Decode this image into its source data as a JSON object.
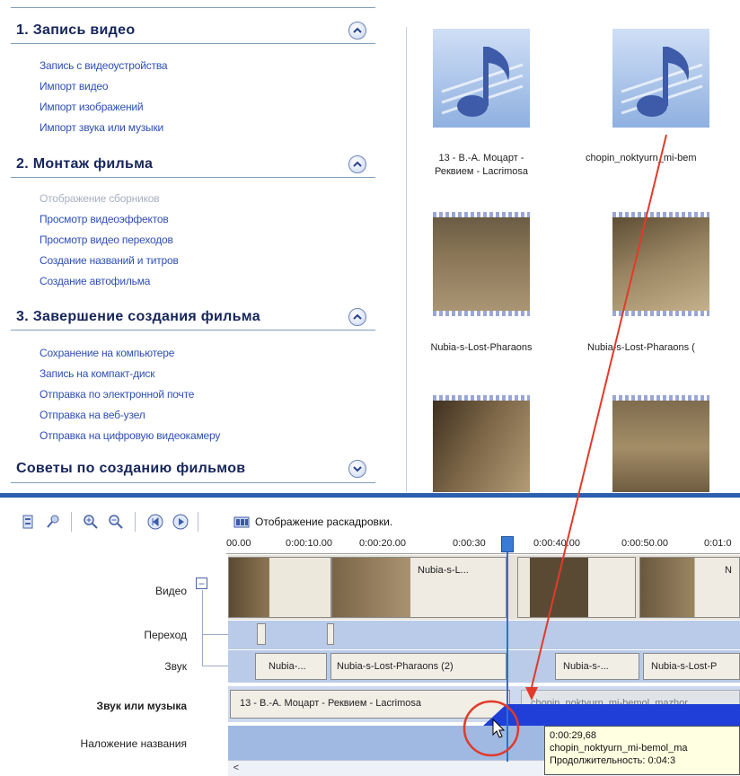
{
  "task_pane": {
    "sections": [
      {
        "title": "1. Запись видео",
        "links": [
          "Запись с видеоустройства",
          "Импорт видео",
          "Импорт изображений",
          "Импорт звука или музыки"
        ],
        "disabled_links": []
      },
      {
        "title": "2. Монтаж фильма",
        "links": [
          "Отображение сборников",
          "Просмотр видеоэффектов",
          "Просмотр видео переходов",
          "Создание названий и титров",
          "Создание автофильма"
        ],
        "disabled_links": [
          "Отображение сборников"
        ]
      },
      {
        "title": "3. Завершение создания фильма",
        "links": [
          "Сохранение на компьютере",
          "Запись на компакт-диск",
          "Отправка по электронной почте",
          "Отправка на веб-узел",
          "Отправка на цифровую видеокамеру"
        ],
        "disabled_links": []
      },
      {
        "title": "Советы по созданию фильмов",
        "links": [],
        "disabled_links": []
      }
    ]
  },
  "collection": {
    "items": [
      {
        "caption": "13 - В.-А. Моцарт -\nРеквием - Lacrimosa",
        "kind": "music-icon"
      },
      {
        "caption": "chopin_noktyurn_mi-bem",
        "kind": "music-icon"
      },
      {
        "caption": "Nubia-s-Lost-Pharaons",
        "kind": "video-thumb"
      },
      {
        "caption": "Nubia-s-Lost-Pharaons (",
        "kind": "video-thumb"
      },
      {
        "caption": "",
        "kind": "video-thumb"
      },
      {
        "caption": "",
        "kind": "video-thumb"
      }
    ]
  },
  "timeline": {
    "storyboard_button_label": "Отображение раскадровки.",
    "ruler_ticks": [
      "00.00",
      "0:00:10.00",
      "0:00:20.00",
      "0:00:30",
      "0:00:40.00",
      "0:00:50.00",
      "0:01:0"
    ],
    "tracks": {
      "video": "Видео",
      "transition": "Переход",
      "audio": "Звук",
      "music": "Звук или музыка",
      "title_overlay": "Наложение названия"
    },
    "video_clips": [
      "Nubia-s-L...",
      "N"
    ],
    "audio_clips": [
      "Nubia-...",
      "Nubia-s-Lost-Pharaons (2)",
      "Nubia-s-...",
      "Nubia-s-Lost-P"
    ],
    "music_clips": [
      "13 - В.-А. Моцарт - Реквием - Lacrimosa",
      "chopin_noktyurn_mi-bemol_mazhor"
    ],
    "expand_symbol": "−",
    "scroll_left_symbol": "<"
  },
  "tooltip": {
    "line1": "0:00:29,68",
    "line2": "chopin_noktyurn_mi-bemol_ma",
    "line3": "Продолжительность: 0:04:3"
  },
  "colors": {
    "accent": "#2f4fb3",
    "section_title": "#16255b",
    "track_bg": "#b9cbe8",
    "drag_arrow": "#e23a2a",
    "music_block": "#1f3fd8"
  }
}
